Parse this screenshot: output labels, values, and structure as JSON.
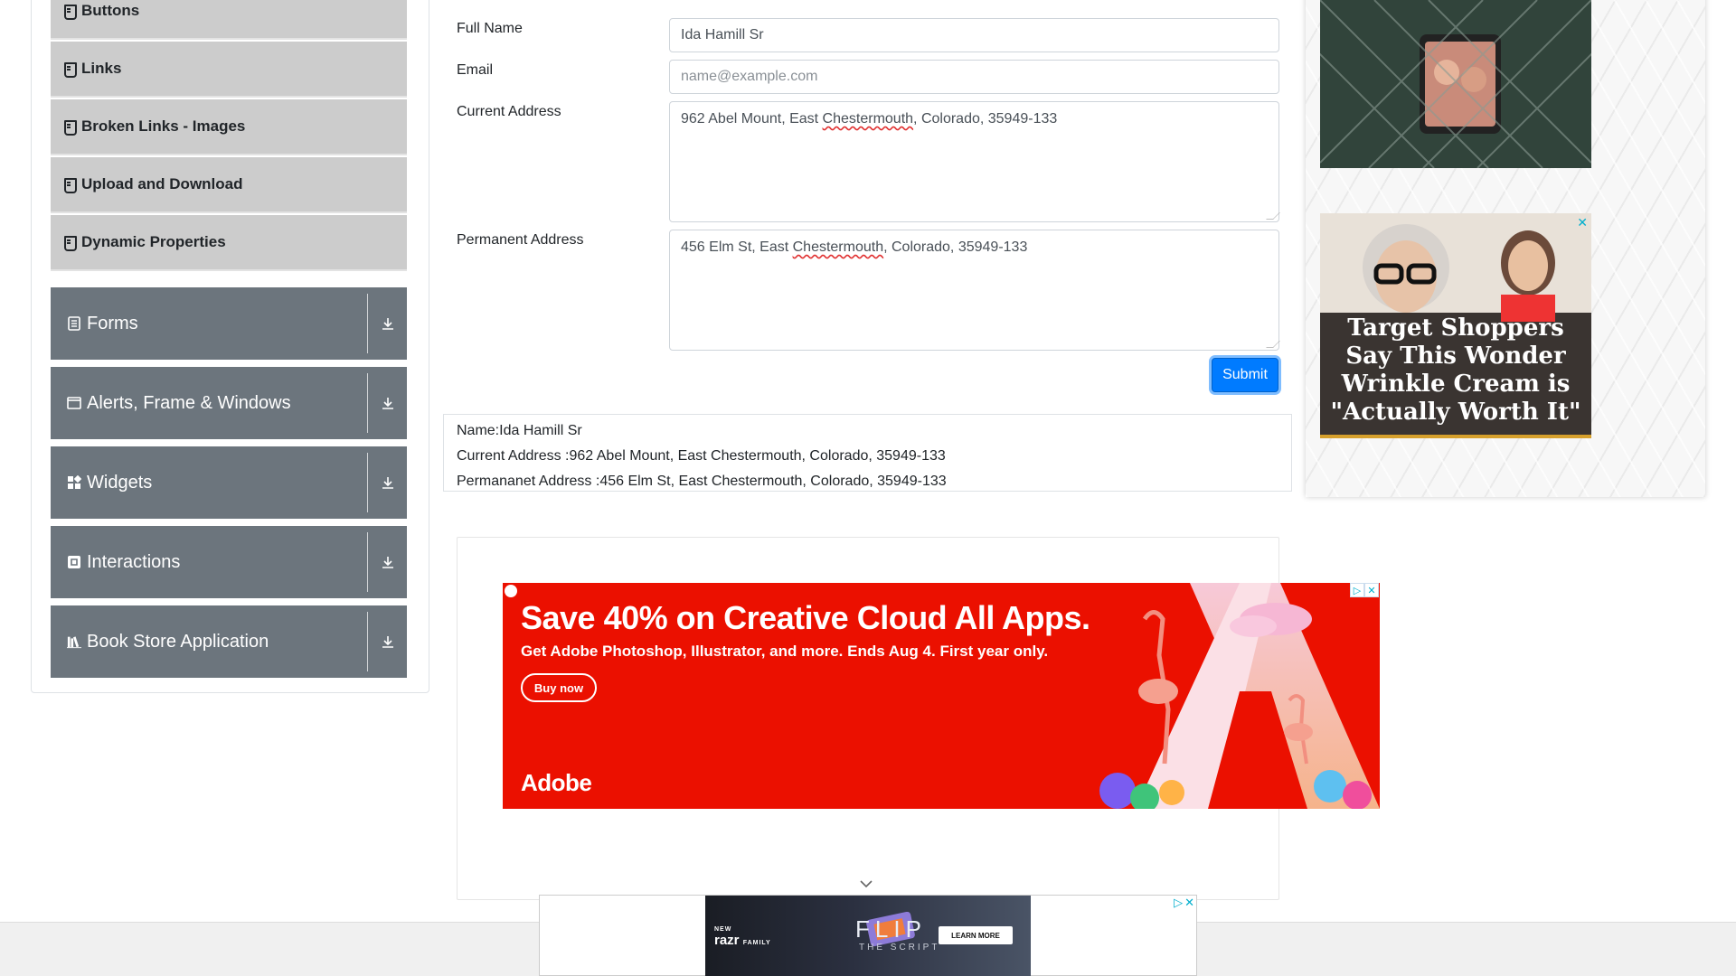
{
  "sidebar": {
    "sub_items": [
      {
        "label": "Buttons"
      },
      {
        "label": "Links"
      },
      {
        "label": "Broken Links - Images"
      },
      {
        "label": "Upload and Download"
      },
      {
        "label": "Dynamic Properties"
      }
    ],
    "groups": [
      {
        "label": "Forms",
        "icon": "form-icon"
      },
      {
        "label": "Alerts, Frame & Windows",
        "icon": "window-icon"
      },
      {
        "label": "Widgets",
        "icon": "widgets-icon"
      },
      {
        "label": "Interactions",
        "icon": "interactions-icon"
      },
      {
        "label": "Book Store Application",
        "icon": "book-icon"
      }
    ]
  },
  "form": {
    "full_name_label": "Full Name",
    "full_name_value": "Ida Hamill Sr",
    "email_label": "Email",
    "email_placeholder": "name@example.com",
    "current_address_label": "Current Address",
    "current_address_value_pre": "962 Abel Mount, East ",
    "current_address_value_word": "Chestermouth",
    "current_address_value_post": ", Colorado, 35949-133",
    "permanent_address_label": "Permanent Address",
    "permanent_address_value_pre": "456 Elm St, East ",
    "permanent_address_value_word": "Chestermouth",
    "permanent_address_value_post": ", Colorado, 35949-133",
    "submit_label": "Submit"
  },
  "output": {
    "name": "Name:Ida Hamill Sr",
    "current_address": "Current Address :962 Abel Mount, East Chestermouth, Colorado, 35949-133",
    "permanent_address": "Permananet Address :456 Elm St, East Chestermouth, Colorado, 35949-133"
  },
  "ads": {
    "adobe": {
      "headline": "Save 40% on Creative Cloud All Apps.",
      "subline": "Get Adobe Photoshop, Illustrator, and more. Ends Aug 4. First year only.",
      "button": "Buy now",
      "brand": "Adobe",
      "background": "#eb1000"
    },
    "target": {
      "text": "Target Shoppers Say This Wonder Wrinkle Cream is \"Actually Worth It\""
    },
    "razr": {
      "brand_small": "NEW",
      "brand": "razr",
      "brand_sub": "FAMILY",
      "headline": "FLIP",
      "tagline": "THE SCRIPT",
      "button": "LEARN MORE"
    }
  },
  "colors": {
    "accent": "#007bff",
    "sidebar_group": "#6c757d",
    "sidebar_sub": "#cccccc"
  }
}
